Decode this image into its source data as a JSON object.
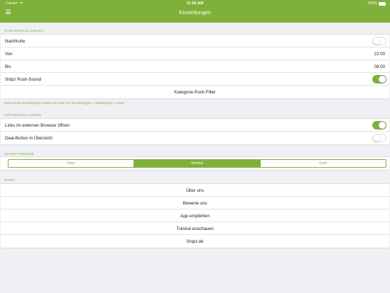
{
  "status": {
    "carrier": "Carrier",
    "time": "11:00 AM",
    "battery": "100%"
  },
  "nav": {
    "title": "Einstellungen"
  },
  "push": {
    "header": "PUSH EINSTELLUNGEN",
    "quiet_label": "Nachtruhe",
    "quiet_on": false,
    "from_label": "Von",
    "from_value": "22:00",
    "to_label": "Bis",
    "to_value": "08:00",
    "sound_label": "Snipz Push-Sound",
    "sound_on": true,
    "filter_label": "Kategorie-Push-Filter",
    "note": "Deine Push-Einstellungen findest du unter iOS Einstellungen > Mitteilungen > Snipz"
  },
  "app": {
    "header": "APP-EINSTELLUNGEN",
    "external_label": "Links im externen Browser öffnen",
    "external_on": true,
    "deal_label": "Deal-Button in Übersicht",
    "deal_on": false
  },
  "font": {
    "header": "SCHRIFTGRÖSSE",
    "options": [
      "Klein",
      "Normal",
      "Groß"
    ],
    "selected": "Normal"
  },
  "snipz": {
    "header": "SNIPZ",
    "items": [
      "Über uns",
      "Bewerte uns",
      "App empfehlen",
      "Tutorial anschauen",
      "Snipz.de"
    ]
  },
  "colors": {
    "accent": "#7fb13a",
    "background": "#efeff4"
  }
}
